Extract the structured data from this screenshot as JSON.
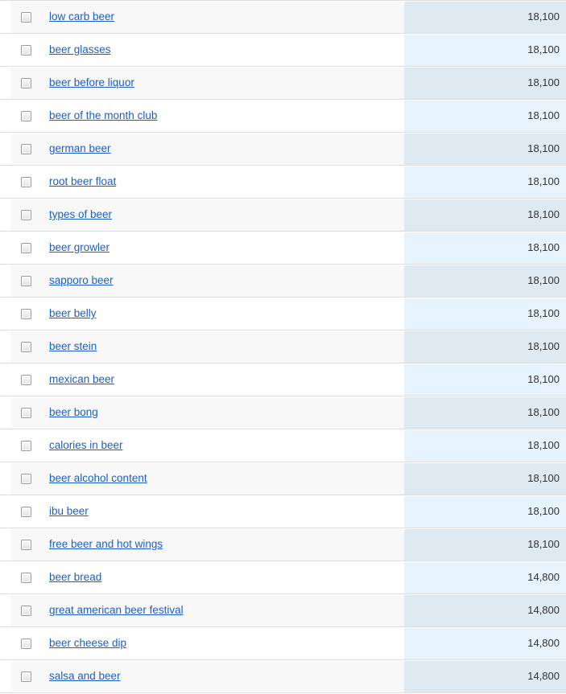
{
  "table": {
    "columns": [
      "keyword",
      "volume"
    ],
    "checkbox_icon": "checkbox-unchecked-icon",
    "accent_link_color": "#1c5fc4",
    "band_a_left_bg": "#f8f8f8",
    "band_a_right_bg": "#dfe9f2",
    "band_b_left_bg": "#ffffff",
    "band_b_right_bg": "#e6f3fc",
    "row_border_color": "#dddddd",
    "rows": [
      {
        "keyword": "low carb beer",
        "volume": "18,100"
      },
      {
        "keyword": "beer glasses",
        "volume": "18,100"
      },
      {
        "keyword": "beer before liquor",
        "volume": "18,100"
      },
      {
        "keyword": "beer of the month club",
        "volume": "18,100"
      },
      {
        "keyword": "german beer",
        "volume": "18,100"
      },
      {
        "keyword": "root beer float",
        "volume": "18,100"
      },
      {
        "keyword": "types of beer",
        "volume": "18,100"
      },
      {
        "keyword": "beer growler",
        "volume": "18,100"
      },
      {
        "keyword": "sapporo beer",
        "volume": "18,100"
      },
      {
        "keyword": "beer belly",
        "volume": "18,100"
      },
      {
        "keyword": "beer stein",
        "volume": "18,100"
      },
      {
        "keyword": "mexican beer",
        "volume": "18,100"
      },
      {
        "keyword": "beer bong",
        "volume": "18,100"
      },
      {
        "keyword": "calories in beer",
        "volume": "18,100"
      },
      {
        "keyword": "beer alcohol content",
        "volume": "18,100"
      },
      {
        "keyword": "ibu beer",
        "volume": "18,100"
      },
      {
        "keyword": "free beer and hot wings",
        "volume": "18,100"
      },
      {
        "keyword": "beer bread",
        "volume": "14,800"
      },
      {
        "keyword": "great american beer festival",
        "volume": "14,800"
      },
      {
        "keyword": "beer cheese dip",
        "volume": "14,800"
      },
      {
        "keyword": "salsa and beer",
        "volume": "14,800"
      }
    ]
  }
}
